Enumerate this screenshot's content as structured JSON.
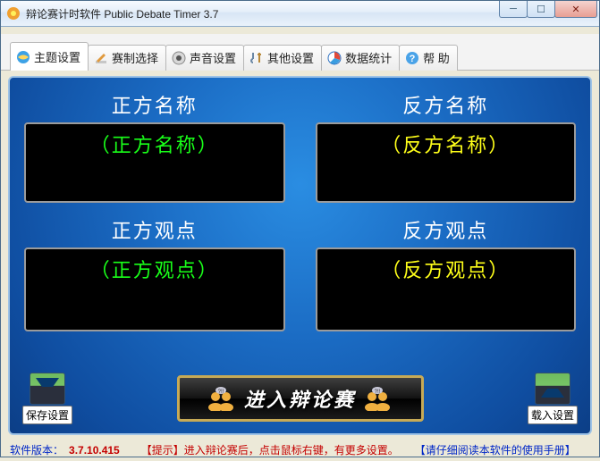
{
  "titlebar": {
    "title": "辩论赛计时软件 Public Debate Timer 3.7"
  },
  "tabs": [
    {
      "label": "主题设置"
    },
    {
      "label": "赛制选择"
    },
    {
      "label": "声音设置"
    },
    {
      "label": "其他设置"
    },
    {
      "label": "数据统计"
    },
    {
      "label": "帮 助"
    }
  ],
  "panels": {
    "proNameTitle": "正方名称",
    "proNameValue": "（正方名称）",
    "conNameTitle": "反方名称",
    "conNameValue": "（反方名称）",
    "proViewTitle": "正方观点",
    "proViewValue": "（正方观点）",
    "conViewTitle": "反方观点",
    "conViewValue": "（反方观点）"
  },
  "buttons": {
    "save": "保存设置",
    "load": "载入设置",
    "enter": "进入辩论赛"
  },
  "status": {
    "versionLabel": "软件版本：",
    "version": "3.7.10.415",
    "tip": "【提示】进入辩论赛后，点击鼠标右键，有更多设置。",
    "manual": "【请仔细阅读本软件的使用手册】"
  }
}
